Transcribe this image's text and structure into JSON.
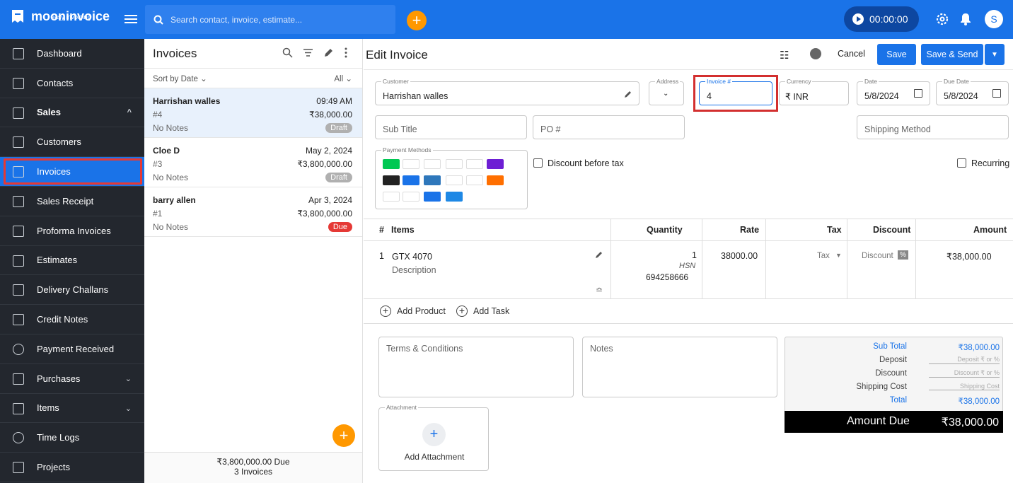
{
  "topbar": {
    "logo": "mooninvoice",
    "logo_sub": "easy invoicing",
    "search_placeholder": "Search contact, invoice, estimate...",
    "timer": "00:00:00",
    "avatar": "S"
  },
  "sidebar": {
    "items": [
      {
        "label": "Dashboard"
      },
      {
        "label": "Contacts"
      },
      {
        "label": "Sales",
        "chevron": "^"
      },
      {
        "label": "Customers"
      },
      {
        "label": "Invoices"
      },
      {
        "label": "Sales Receipt"
      },
      {
        "label": "Proforma Invoices"
      },
      {
        "label": "Estimates"
      },
      {
        "label": "Delivery Challans"
      },
      {
        "label": "Credit Notes"
      },
      {
        "label": "Payment Received"
      },
      {
        "label": "Purchases",
        "chevron": "⌄"
      },
      {
        "label": "Items",
        "chevron": "⌄"
      },
      {
        "label": "Time Logs"
      },
      {
        "label": "Projects"
      }
    ]
  },
  "list": {
    "title": "Invoices",
    "sort": "Sort by Date ⌄",
    "filter": "All ⌄",
    "invoices": [
      {
        "name": "Harrishan walles",
        "date": "09:49 AM",
        "number": "#4",
        "amount": "₹38,000.00",
        "notes": "No Notes",
        "status": "Draft"
      },
      {
        "name": "Cloe D",
        "date": "May 2, 2024",
        "number": "#3",
        "amount": "₹3,800,000.00",
        "notes": "No Notes",
        "status": "Draft"
      },
      {
        "name": "barry allen",
        "date": "Apr 3, 2024",
        "number": "#1",
        "amount": "₹3,800,000.00",
        "notes": "No Notes",
        "status": "Due"
      }
    ],
    "footer_due": "₹3,800,000.00  Due",
    "footer_count": "3 Invoices"
  },
  "edit": {
    "title": "Edit Invoice",
    "cancel": "Cancel",
    "save": "Save",
    "save_send": "Save & Send",
    "customer_label": "Customer",
    "customer": "Harrishan walles",
    "address_label": "Address",
    "invoice_label": "Invoice #",
    "invoice_no": "4",
    "currency_label": "Currency",
    "currency": "₹ INR",
    "date_label": "Date",
    "date": "5/8/2024",
    "due_label": "Due Date",
    "due": "5/8/2024",
    "subtitle_ph": "Sub Title",
    "po_ph": "PO #",
    "shipping_ph": "Shipping Method",
    "payment_label": "Payment Methods",
    "discount_before_tax": "Discount before tax",
    "recurring": "Recurring"
  },
  "table": {
    "headers": {
      "num": "#",
      "items": "Items",
      "qty": "Quantity",
      "rate": "Rate",
      "tax": "Tax",
      "discount": "Discount",
      "amount": "Amount"
    },
    "row": {
      "num": "1",
      "item": "GTX 4070",
      "desc": "Description",
      "qty": "1",
      "hsn_label": "HSN",
      "hsn": "694258666",
      "rate": "38000.00",
      "tax": "Tax",
      "discount": "Discount",
      "amount": "₹38,000.00"
    }
  },
  "actions": {
    "add_product": "Add Product",
    "add_task": "Add Task"
  },
  "terms_ph": "Terms & Conditions",
  "notes_ph": "Notes",
  "attachment_label": "Attachment",
  "add_attachment": "Add Attachment",
  "totals": {
    "subtotal_label": "Sub Total",
    "subtotal": "₹38,000.00",
    "deposit_label": "Deposit",
    "deposit_ph": "Deposit ₹ or %",
    "discount_label": "Discount",
    "discount_ph": "Discount ₹ or %",
    "shipping_label": "Shipping Cost",
    "shipping_ph": "Shipping Cost",
    "total_label": "Total",
    "total": "₹38,000.00",
    "amount_due_label": "Amount Due",
    "amount_due": "₹38,000.00"
  }
}
